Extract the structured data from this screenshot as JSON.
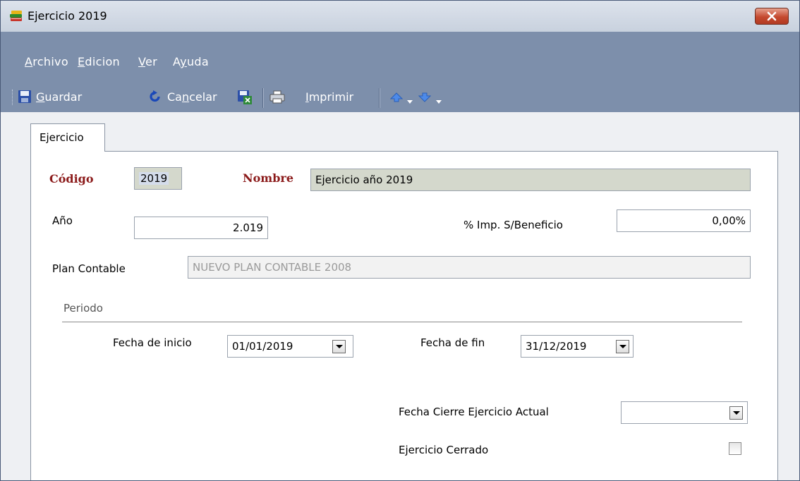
{
  "window": {
    "title": "Ejercicio 2019",
    "icon": "books-icon",
    "close_icon": "close-icon"
  },
  "menu": {
    "archivo": {
      "hot": "A",
      "rest": "rchivo"
    },
    "edicion": {
      "hot": "E",
      "rest": "dicion"
    },
    "ver": {
      "hot": "V",
      "rest": "er"
    },
    "ayuda": {
      "pre": "A",
      "hot": "y",
      "rest": "uda"
    }
  },
  "toolbar": {
    "guardar": {
      "hot": "G",
      "rest": "uardar"
    },
    "cancelar": {
      "pre": "Ca",
      "hot": "n",
      "rest": "celar"
    },
    "imprimir": {
      "hot": "I",
      "rest": "mprimir"
    }
  },
  "tab": {
    "label": "Ejercicio"
  },
  "form": {
    "codigo_label": "Código",
    "codigo_value": "2019",
    "nombre_label": "Nombre",
    "nombre_value": "Ejercicio año 2019",
    "anio_label": "Año",
    "anio_value": "2.019",
    "imp_label": "% Imp. S/Beneficio",
    "imp_value": "0,00%",
    "plan_label": "Plan Contable",
    "plan_value": "NUEVO PLAN CONTABLE 2008",
    "periodo_label": "Periodo",
    "inicio_label": "Fecha de inicio",
    "inicio_value": "01/01/2019",
    "fin_label": "Fecha de fin",
    "fin_value": "31/12/2019",
    "cierre_label": "Fecha Cierre Ejercicio Actual",
    "cierre_value": "",
    "cerrado_label": "Ejercicio Cerrado",
    "cerrado_checked": false
  },
  "colors": {
    "menu_bg": "#7d8fab",
    "required_label": "#8b1a1a",
    "readonly_bg": "#d4d8cc"
  }
}
